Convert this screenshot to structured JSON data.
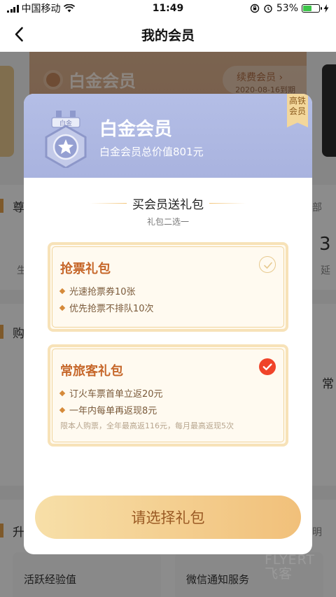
{
  "status_bar": {
    "carrier": "中国移动",
    "time": "11:49",
    "battery_percent": "53%",
    "battery_level": 0.53
  },
  "nav": {
    "title": "我的会员"
  },
  "background": {
    "card_title": "白金会员",
    "renew_label": "续费会员",
    "expiry": "2020-08-16到期",
    "section1_title": "尊",
    "section1_right": "部",
    "left_small": "生",
    "stat_number": "3",
    "stat_label": "延",
    "section2_title": "购",
    "section2_right": "常",
    "section3_title": "升",
    "section3_right": "明",
    "bottom_item1": "活跃经验值",
    "bottom_item2": "微信通知服务"
  },
  "modal": {
    "header_title": "白金会员",
    "header_subtitle": "白金会员总价值801元",
    "medal_label": "白金",
    "badge_line1": "高铁",
    "badge_line2": "会员",
    "gift_title": "买会员送礼包",
    "gift_subtitle": "礼包二选一",
    "packages": [
      {
        "name": "抢票礼包",
        "items": [
          "光速抢票券10张",
          "优先抢票不排队10次"
        ],
        "note": "",
        "selected": false
      },
      {
        "name": "常旅客礼包",
        "items": [
          "订火车票首单立返20元",
          "一年内每单再返现8元"
        ],
        "note": "限本人购票，全年最高返116元，每月最高返现5次",
        "selected": true
      }
    ],
    "select_button": "请选择礼包"
  },
  "watermark": {
    "line1": "FLYERT",
    "line2": "飞客"
  },
  "colors": {
    "accent": "#c6672a",
    "selected_check": "#f0442a",
    "header_bg": "#aab4e0",
    "button_start": "#f7dfa8",
    "button_end": "#f1c07a"
  },
  "icons": [
    "back-chevron-icon",
    "wifi-icon",
    "lock-rotation-icon",
    "alarm-icon",
    "charging-icon",
    "medal-icon",
    "check-circle-icon"
  ]
}
